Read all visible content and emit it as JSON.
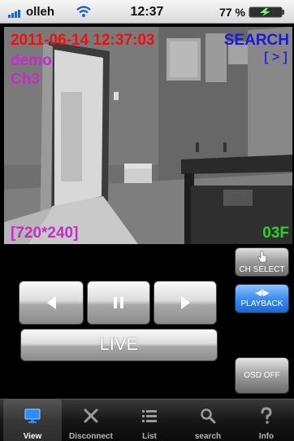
{
  "status_bar": {
    "carrier": "olleh",
    "time": "12:37",
    "battery": "77 %"
  },
  "camera": {
    "datetime": "2011-06-14 12:37:03",
    "mode": "SEARCH",
    "page_indicator": "[ > ]",
    "site": "demo",
    "channel": "Ch3",
    "resolution": "[720*240]",
    "frame_label": "03F"
  },
  "controls": {
    "live_label": "LIVE",
    "ch_select_label": "CH SELECT",
    "playback_label": "PLAYBACK",
    "playback_icon": "◀‖▶",
    "osd_label": "OSD OFF"
  },
  "tabs": [
    {
      "label": "View",
      "icon": "monitor-icon"
    },
    {
      "label": "Disconnect",
      "icon": "disconnect-icon"
    },
    {
      "label": "List",
      "icon": "list-icon"
    },
    {
      "label": "search",
      "icon": "search-icon"
    },
    {
      "label": "Info",
      "icon": "question-icon"
    }
  ],
  "colors": {
    "datetime": "#ee1111",
    "mode": "#1a1ad8",
    "site": "#c32ec3",
    "frame": "#2fcf2f",
    "playback": "#3d8ef0"
  }
}
